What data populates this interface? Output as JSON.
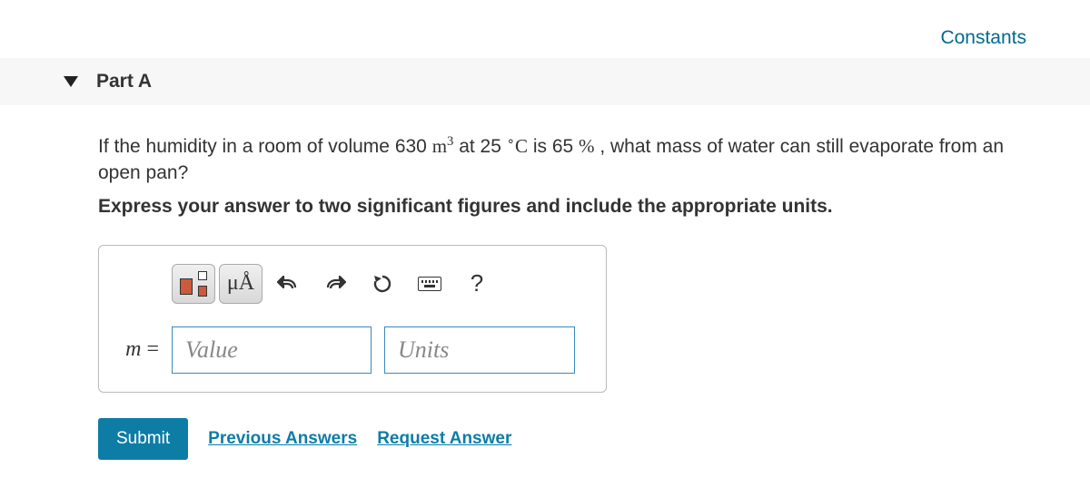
{
  "header": {
    "constants_link": "Constants",
    "part_label": "Part A"
  },
  "question": {
    "prefix": "If the humidity in a room of volume 630 ",
    "unit_base": "m",
    "unit_exp": "3",
    "mid1": " at 25 ",
    "degree": "∘",
    "temp_unit": "C",
    "mid2": " is 65 ",
    "percent": "%",
    "suffix": " , what mass of water can still evaporate from an open pan?",
    "instruction": "Express your answer to two significant figures and include the appropriate units."
  },
  "toolbar": {
    "symbols_label": "μÅ",
    "help_label": "?"
  },
  "input": {
    "variable": "m",
    "equals": " =",
    "value_placeholder": "Value",
    "units_placeholder": "Units"
  },
  "buttons": {
    "submit": "Submit",
    "previous": "Previous Answers",
    "request": "Request Answer"
  }
}
